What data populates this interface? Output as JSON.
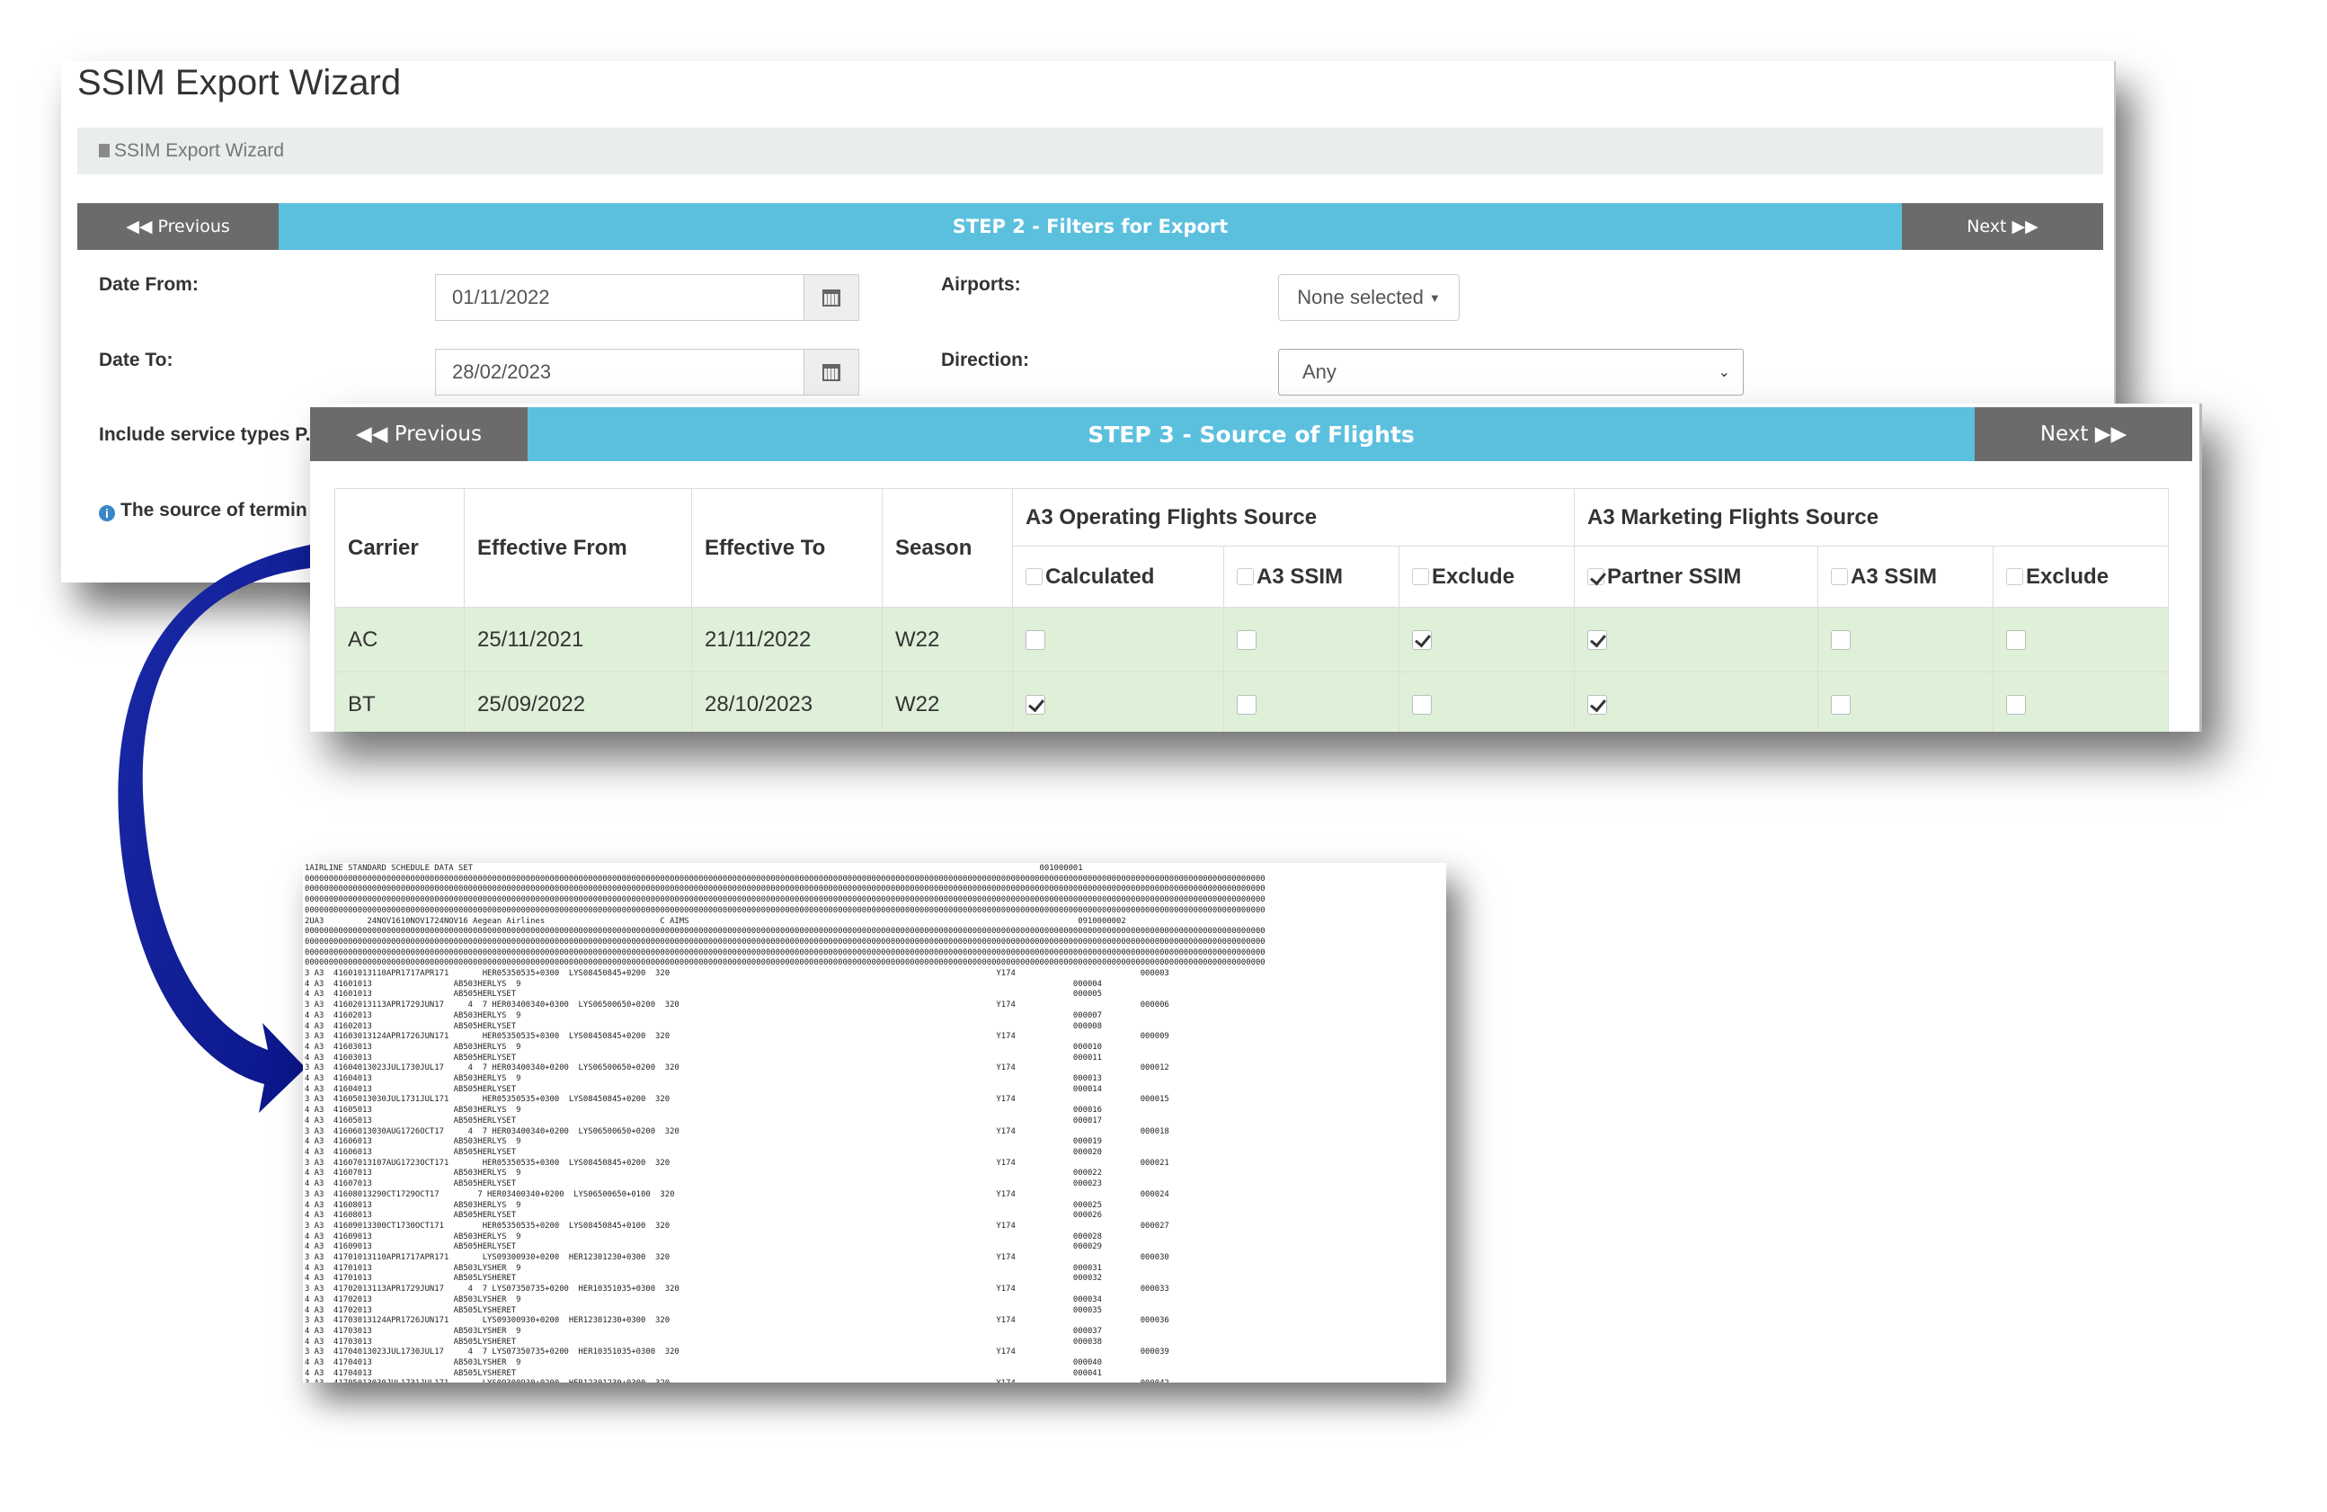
{
  "step2": {
    "page_title": "SSIM Export Wizard",
    "breadcrumb": "SSIM Export Wizard",
    "previous_label": "Previous",
    "step_title": "STEP 2 - Filters for Export",
    "next_label": "Next",
    "date_from_label": "Date From:",
    "date_from_value": "01/11/2022",
    "date_to_label": "Date To:",
    "date_to_value": "28/02/2023",
    "airports_label": "Airports:",
    "airports_value": "None selected",
    "direction_label": "Direction:",
    "direction_value": "Any",
    "include_label": "Include service types P.",
    "source_note": "The source of termin"
  },
  "step3": {
    "previous_label": "Previous",
    "step_title": "STEP 3 - Source of Flights",
    "next_label": "Next",
    "columns": {
      "carrier": "Carrier",
      "effective_from": "Effective From",
      "effective_to": "Effective To",
      "season": "Season",
      "operating_group": "A3 Operating Flights Source",
      "marketing_group": "A3 Marketing Flights Source",
      "op_calculated": "Calculated",
      "op_a3ssim": "A3 SSIM",
      "op_exclude": "Exclude",
      "mk_partner": "Partner SSIM",
      "mk_a3ssim": "A3 SSIM",
      "mk_exclude": "Exclude"
    },
    "header_checks": {
      "op_calculated": false,
      "op_a3ssim": false,
      "op_exclude": false,
      "mk_partner": true,
      "mk_a3ssim": false,
      "mk_exclude": false
    },
    "rows": [
      {
        "carrier": "AC",
        "effective_from": "25/11/2021",
        "effective_to": "21/11/2022",
        "season": "W22",
        "checks": [
          false,
          false,
          true,
          true,
          false,
          false
        ]
      },
      {
        "carrier": "BT",
        "effective_from": "25/09/2022",
        "effective_to": "28/10/2023",
        "season": "W22",
        "checks": [
          true,
          false,
          false,
          true,
          false,
          false
        ]
      }
    ]
  },
  "ssim_text": "1AIRLINE STANDARD SCHEDULE DATA SET                                                                                                                      001000001\n00000000000000000000000000000000000000000000000000000000000000000000000000000000000000000000000000000000000000000000000000000000000000000000000000000000000000000000000000000000000000000000000000000000\n00000000000000000000000000000000000000000000000000000000000000000000000000000000000000000000000000000000000000000000000000000000000000000000000000000000000000000000000000000000000000000000000000000000\n00000000000000000000000000000000000000000000000000000000000000000000000000000000000000000000000000000000000000000000000000000000000000000000000000000000000000000000000000000000000000000000000000000000\n00000000000000000000000000000000000000000000000000000000000000000000000000000000000000000000000000000000000000000000000000000000000000000000000000000000000000000000000000000000000000000000000000000000\n2UA3         24NOV1610NOV1724NOV16 Aegean Airlines                        C AIMS                                                                                 0910000002\n00000000000000000000000000000000000000000000000000000000000000000000000000000000000000000000000000000000000000000000000000000000000000000000000000000000000000000000000000000000000000000000000000000000\n00000000000000000000000000000000000000000000000000000000000000000000000000000000000000000000000000000000000000000000000000000000000000000000000000000000000000000000000000000000000000000000000000000000\n00000000000000000000000000000000000000000000000000000000000000000000000000000000000000000000000000000000000000000000000000000000000000000000000000000000000000000000000000000000000000000000000000000000\n00000000000000000000000000000000000000000000000000000000000000000000000000000000000000000000000000000000000000000000000000000000000000000000000000000000000000000000000000000000000000000000000000000000\n3 A3  41601013110APR1717APR171       HER05350535+0300  LYS08450845+0200  320                                                                    Y174                          000003\n4 A3  41601013                 AB503HERLYS  9                                                                                                                   000004\n4 A3  41601013                 AB505HERLYSET                                                                                                                    000005\n3 A3  41602013113APR1729JUN17     4  7 HER03400340+0300  LYS06500650+0200  320                                                                  Y174                          000006\n4 A3  41602013                 AB503HERLYS  9                                                                                                                   000007\n4 A3  41602013                 AB505HERLYSET                                                                                                                    000008\n3 A3  41603013124APR1726JUN171       HER05350535+0300  LYS08450845+0200  320                                                                    Y174                          000009\n4 A3  41603013                 AB503HERLYS  9                                                                                                                   000010\n4 A3  41603013                 AB505HERLYSET                                                                                                                    000011\n3 A3  41604013023JUL1730JUL17     4  7 HER03400340+0200  LYS06500650+0200  320                                                                  Y174                          000012\n4 A3  41604013                 AB503HERLYS  9                                                                                                                   000013\n4 A3  41604013                 AB505HERLYSET                                                                                                                    000014\n3 A3  41605013030JUL1731JUL171       HER05350535+0300  LYS08450845+0200  320                                                                    Y174                          000015\n4 A3  41605013                 AB503HERLYS  9                                                                                                                   000016\n4 A3  41605013                 AB505HERLYSET                                                                                                                    000017\n3 A3  41606013030AUG1726OCT17     4  7 HER03400340+0200  LYS06500650+0200  320                                                                  Y174                          000018\n4 A3  41606013                 AB503HERLYS  9                                                                                                                   000019\n4 A3  41606013                 AB505HERLYSET                                                                                                                    000020\n3 A3  41607013107AUG1723OCT171       HER05350535+0300  LYS08450845+0200  320                                                                    Y174                          000021\n4 A3  41607013                 AB503HERLYS  9                                                                                                                   000022\n4 A3  41607013                 AB505HERLYSET                                                                                                                    000023\n3 A3  41608013290CT1729OCT17        7 HER03400340+0200  LYS06500650+0100  320                                                                   Y174                          000024\n4 A3  41608013                 AB503HERLYS  9                                                                                                                   000025\n4 A3  41608013                 AB505HERLYSET                                                                                                                    000026\n3 A3  41609013300CT1730OCT171        HER05350535+0200  LYS08450845+0100  320                                                                    Y174                          000027\n4 A3  41609013                 AB503HERLYS  9                                                                                                                   000028\n4 A3  41609013                 AB505HERLYSET                                                                                                                    000029\n3 A3  41701013110APR1717APR171       LYS09300930+0200  HER12301230+0300  320                                                                    Y174                          000030\n4 A3  41701013                 AB503LYSHER  9                                                                                                                   000031\n4 A3  41701013                 AB505LYSHERET                                                                                                                    000032\n3 A3  41702013113APR1729JUN17     4  7 LYS07350735+0200  HER10351035+0300  320                                                                  Y174                          000033\n4 A3  41702013                 AB503LYSHER  9                                                                                                                   000034\n4 A3  41702013                 AB505LYSHERET                                                                                                                    000035\n3 A3  41703013124APR1726JUN171       LYS09300930+0200  HER12301230+0300  320                                                                    Y174                          000036\n4 A3  41703013                 AB503LYSHER  9                                                                                                                   000037\n4 A3  41703013                 AB505LYSHERET                                                                                                                    000038\n3 A3  41704013023JUL1730JUL17     4  7 LYS07350735+0200  HER10351035+0300  320                                                                  Y174                          000039\n4 A3  41704013                 AB503LYSHER  9                                                                                                                   000040\n4 A3  41704013                 AB505LYSHERET                                                                                                                    000041\n3 A3  41705013030JUL1731JUL171       LYS09300930+0200  HER12301230+0300  320                                                                    Y174                          000042"
}
